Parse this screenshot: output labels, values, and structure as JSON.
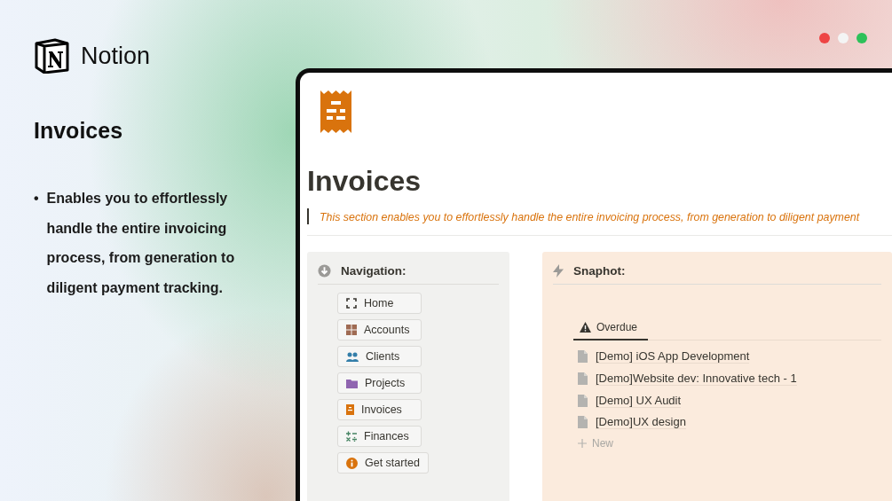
{
  "brand": {
    "name": "Notion"
  },
  "window_dots": [
    {
      "color": "#ee4444"
    },
    {
      "color": "#f4f4f4"
    },
    {
      "color": "#2ec15a"
    }
  ],
  "intro": {
    "title": "Invoices",
    "bullets": [
      {
        "marker": "•",
        "text": "Enables you to effortlessly handle the entire invoicing process, from generation to diligent payment tracking."
      }
    ]
  },
  "page": {
    "title": "Invoices",
    "quote": "This section enables you to effortlessly handle the entire invoicing process, from generation to diligent payment"
  },
  "navigation": {
    "title": "Navigation:",
    "items": [
      {
        "label": "Home",
        "kind": "frame"
      },
      {
        "label": "Accounts",
        "kind": "grid"
      },
      {
        "label": "Clients",
        "kind": "people"
      },
      {
        "label": "Projects",
        "kind": "folder"
      },
      {
        "label": "Invoices",
        "kind": "receipt"
      },
      {
        "label": "Finances",
        "kind": "math"
      },
      {
        "label": "Get started",
        "kind": "info"
      }
    ]
  },
  "snapshot": {
    "title": "Snaphot:",
    "tabs": [
      {
        "label": "Overdue",
        "selected": true
      }
    ],
    "rows": [
      "[Demo] iOS App Development",
      "[Demo]Website dev: Innovative tech - 1",
      "[Demo] UX Audit",
      "[Demo]UX design"
    ],
    "new_label": "New"
  }
}
